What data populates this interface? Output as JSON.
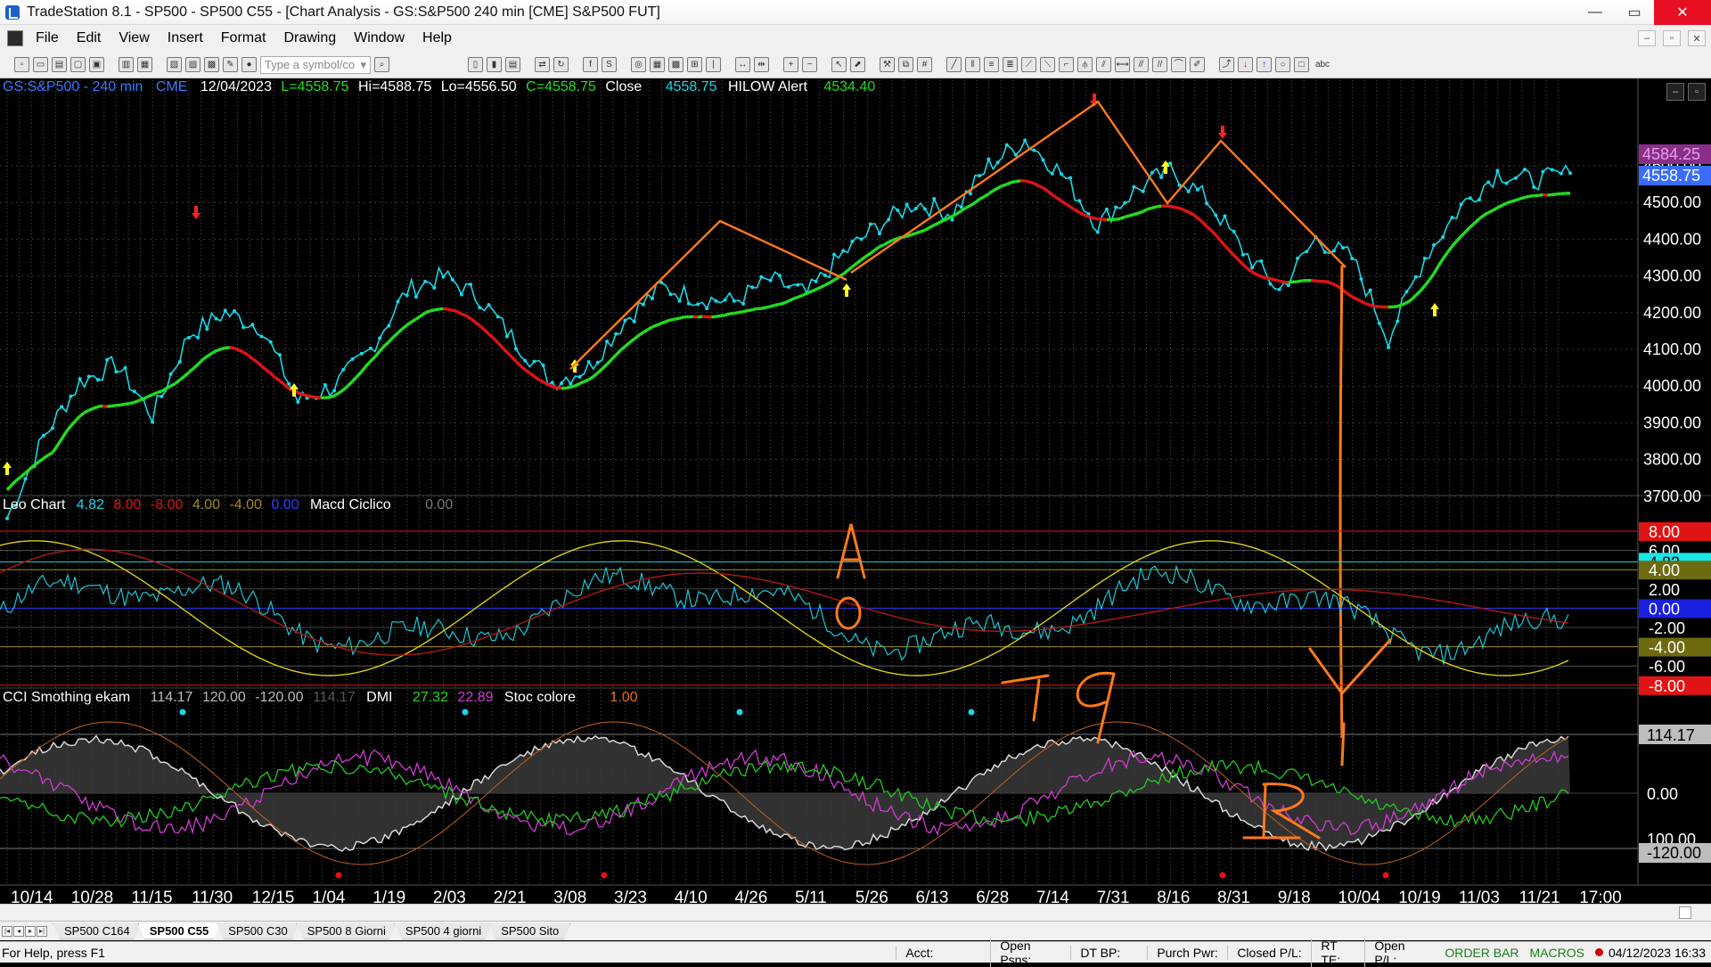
{
  "window": {
    "title": "TradeStation 8.1 - SP500 - SP500 C55 - [Chart Analysis - GS:S&P500  240 min  [CME] S&P500 FUT]",
    "minimize": "—",
    "maximize": "▭",
    "close": "✕"
  },
  "menu": {
    "items": [
      "File",
      "Edit",
      "View",
      "Insert",
      "Format",
      "Drawing",
      "Window",
      "Help"
    ],
    "mdi_min": "–",
    "mdi_restore": "▫",
    "mdi_close": "✕"
  },
  "toolbar": {
    "symbol_placeholder": "Type a symbol/co",
    "abc_label": "abc"
  },
  "price_header": {
    "symbol": "GS:S&P500 - 240 min",
    "exchange": "CME",
    "date": "12/04/2023",
    "last": "L=4558.75",
    "high": "Hi=4588.75",
    "low": "Lo=4556.50",
    "close_val": "C=4558.75",
    "close_label": "Close",
    "close_price": "4558.75",
    "alert_label": "HILOW Alert",
    "alert_value": "4534.40"
  },
  "leo_header": {
    "name": "Leo Chart",
    "v1": "4.82",
    "v2": "8.00",
    "v3": "-8.00",
    "v4": "4.00",
    "v5": "-4.00",
    "v6": "0.00",
    "macd": "Macd Ciclico",
    "macd_val": "0.00"
  },
  "cci_header": {
    "name": "CCI Smothing ekam",
    "v1": "114.17",
    "v2": "120.00",
    "v3": "-120.00",
    "v4": "114.17",
    "dmi": "DMI",
    "dmi1": "27.32",
    "dmi2": "22.89",
    "stoc": "Stoc colore",
    "stoc_val": "1.00"
  },
  "price_axis": {
    "labels": [
      "4600.00",
      "4500.00",
      "4400.00",
      "4300.00",
      "4200.00",
      "4100.00",
      "4000.00",
      "3900.00",
      "3800.00",
      "3700.00"
    ],
    "current_tag": "4558.75",
    "high_tag": "4584.25"
  },
  "leo_axis": {
    "labels": [
      "8.00",
      "6.00",
      "4.82",
      "4.00",
      "2.00",
      "0.00",
      "-2.00",
      "-4.00",
      "-6.00",
      "-8.00"
    ]
  },
  "cci_axis": {
    "labels": [
      "114.17",
      "0.00",
      "100.00",
      "-120.00"
    ]
  },
  "time_axis": {
    "labels": [
      "10/14",
      "10/28",
      "11/15",
      "11/30",
      "12/15",
      "1/04",
      "1/19",
      "2/03",
      "2/21",
      "3/08",
      "3/23",
      "4/10",
      "4/26",
      "5/11",
      "5/26",
      "6/13",
      "6/28",
      "7/14",
      "7/31",
      "8/16",
      "8/31",
      "9/18",
      "10/04",
      "10/19",
      "11/03",
      "11/21",
      "17:00"
    ]
  },
  "annotations": {
    "a": "A",
    "zero": "0",
    "nineteen": "19",
    "r": "R"
  },
  "tabs": [
    "SP500 C164",
    "SP500 C55",
    "SP500 C30",
    "SP500 8 Giorni",
    "SP500 4 giorni",
    "SP500 Sito"
  ],
  "active_tab": "SP500 C55",
  "status": {
    "help": "For Help, press F1",
    "acct": "Acct:",
    "open_psns": "Open Psns:",
    "dt_bp": "DT BP:",
    "purch_pwr": "Purch Pwr:",
    "closed_pl": "Closed P/L:",
    "rt_te": "RT TE:",
    "open_pl": "Open P/L:",
    "order_bar": "ORDER BAR",
    "macros": "MACROS",
    "datetime": "04/12/2023 16:33"
  },
  "colors": {
    "price_line": "#19d7e6",
    "up_avg": "#22dd22",
    "down_avg": "#e01414",
    "annotation": "#ff7a1a",
    "magenta": "#d23cd2",
    "header_blue": "#3c78ff",
    "header_green": "#22dd22"
  },
  "chart_data": {
    "type": "line",
    "series": [
      {
        "name": "Close",
        "values": [
          3640,
          3860,
          4010,
          4060,
          3920,
          4140,
          4200,
          4160,
          3960,
          4000,
          4100,
          4260,
          4300,
          4240,
          4120,
          4010,
          4050,
          4180,
          4270,
          4240,
          4230,
          4290,
          4250,
          4360,
          4440,
          4500,
          4470,
          4600,
          4670,
          4580,
          4440,
          4530,
          4590,
          4510,
          4370,
          4260,
          4400,
          4350,
          4130,
          4350,
          4490,
          4580,
          4560,
          4580
        ]
      }
    ],
    "ylim": [
      3650,
      4650
    ]
  }
}
